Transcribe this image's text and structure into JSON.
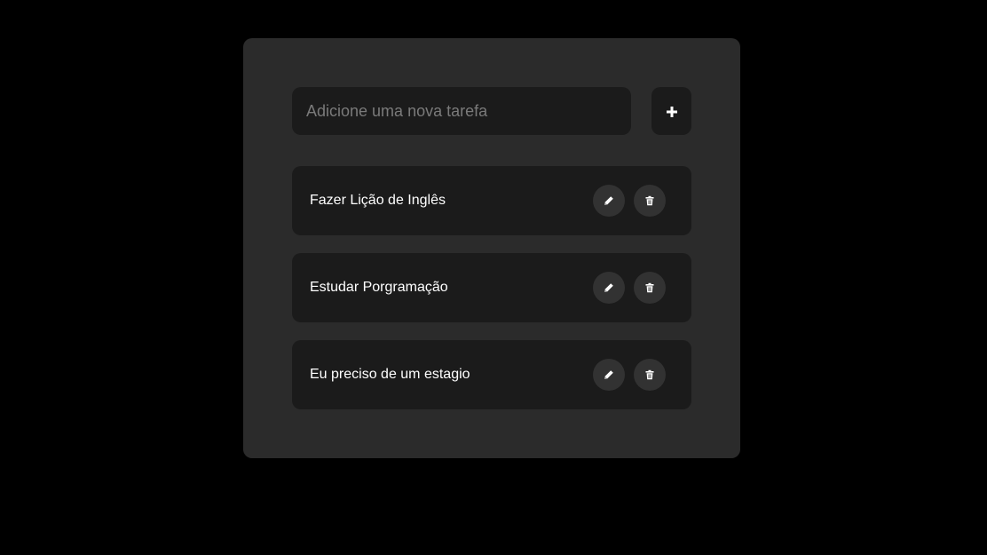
{
  "new_task": {
    "placeholder": "Adicione uma nova tarefa",
    "value": "",
    "add_button_icon": "plus-icon"
  },
  "tasks": [
    {
      "label": "Fazer Lição de Inglês",
      "edit_icon": "pencil-icon",
      "delete_icon": "trash-icon"
    },
    {
      "label": "Estudar Porgramação",
      "edit_icon": "pencil-icon",
      "delete_icon": "trash-icon"
    },
    {
      "label": "Eu preciso de um estagio",
      "edit_icon": "pencil-icon",
      "delete_icon": "trash-icon"
    }
  ],
  "colors": {
    "page_background": "#000000",
    "panel_background": "#2b2b2b",
    "field_background": "#1b1b1b",
    "icon_button_background": "#323232",
    "text": "#ffffff",
    "placeholder": "#7a7a7a"
  }
}
